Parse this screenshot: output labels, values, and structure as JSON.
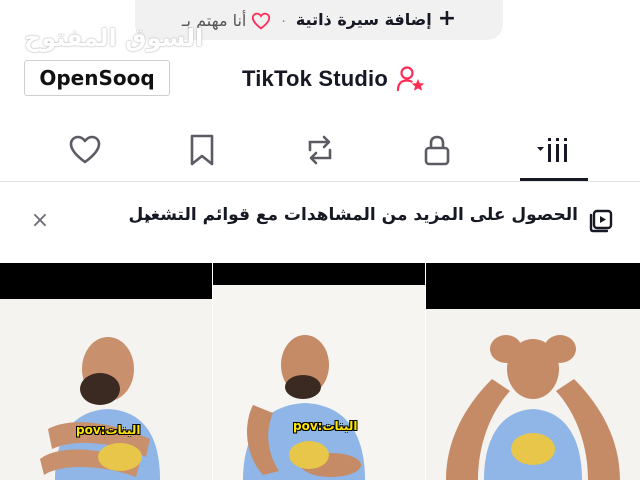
{
  "suggestion_pill": {
    "add_bio_label": "إضافة سيرة ذاتية",
    "separator": "·",
    "interest_label": "أنا مهتم بـ"
  },
  "watermark": {
    "arabic_text": "السوق المفتوح",
    "logo_text": "OpenSooq"
  },
  "studio": {
    "label": "TikTok Studio",
    "icon": "user-star-icon",
    "accent_color": "#fe2c55"
  },
  "tabs": [
    {
      "name": "videos",
      "icon": "grid-filter-icon",
      "active": true
    },
    {
      "name": "private",
      "icon": "lock-icon",
      "active": false
    },
    {
      "name": "reposts",
      "icon": "repost-icon",
      "active": false
    },
    {
      "name": "favorites",
      "icon": "bookmark-icon",
      "active": false
    },
    {
      "name": "liked",
      "icon": "heart-icon",
      "active": false
    }
  ],
  "banner": {
    "text": "الحصول على المزيد من المشاهدات مع قوائم التشغيل",
    "chevron": "›",
    "close_label": "×",
    "icon": "playlist-icon"
  },
  "videos": [
    {
      "caption": "pov:البنات"
    },
    {
      "caption": "pov:البنات"
    },
    {
      "caption": ""
    }
  ],
  "colors": {
    "text": "#161823",
    "muted": "#8a8b91",
    "pill_bg": "#f1f1f2",
    "tshirt": "#8fb6e6"
  }
}
